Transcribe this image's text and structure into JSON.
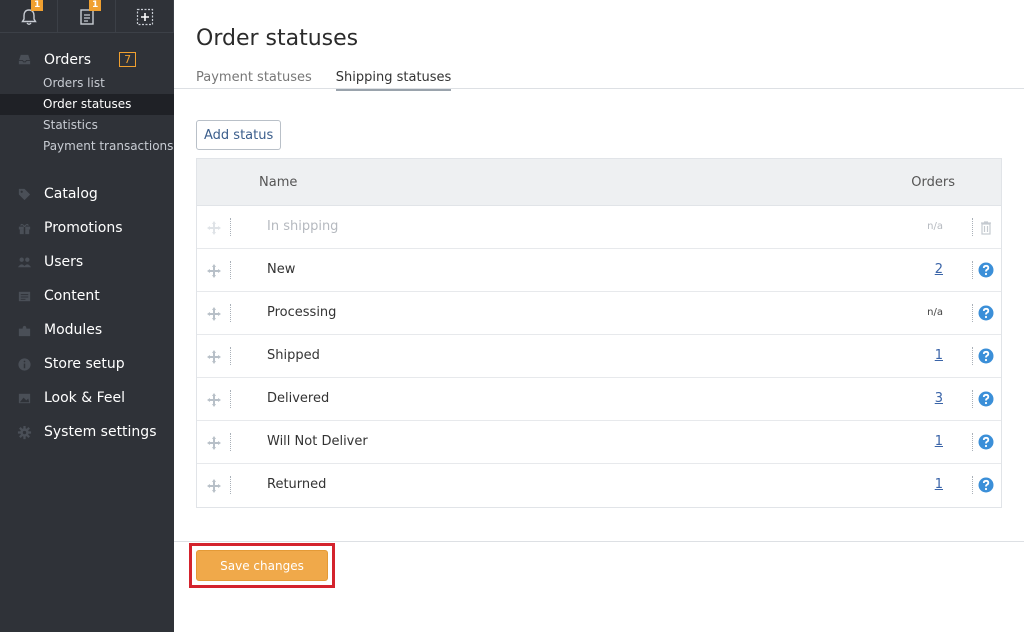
{
  "topbar": {
    "notifications_badge": "1",
    "documents_badge": "1"
  },
  "sidebar": {
    "orders_label": "Orders",
    "orders_count": "7",
    "orders_sub": [
      "Orders list",
      "Order statuses",
      "Statistics",
      "Payment transactions"
    ],
    "items": [
      "Catalog",
      "Promotions",
      "Users",
      "Content",
      "Modules",
      "Store setup",
      "Look & Feel",
      "System settings"
    ]
  },
  "main": {
    "title": "Order statuses",
    "tabs": [
      "Payment statuses",
      "Shipping statuses"
    ],
    "add_status": "Add status",
    "columns": {
      "name": "Name",
      "orders": "Orders"
    },
    "rows": [
      {
        "name": "In shipping",
        "orders": "n/a"
      },
      {
        "name": "New",
        "orders": "2"
      },
      {
        "name": "Processing",
        "orders": "n/a"
      },
      {
        "name": "Shipped",
        "orders": "1"
      },
      {
        "name": "Delivered",
        "orders": "3"
      },
      {
        "name": "Will Not Deliver",
        "orders": "1"
      },
      {
        "name": "Returned",
        "orders": "1"
      }
    ],
    "save_label": "Save changes"
  },
  "colors": {
    "sidebar_bg": "#2f3238",
    "accent": "#f0a94a",
    "link": "#3a64a8",
    "help_icon": "#3b8fd8",
    "highlight_frame": "#d4232d"
  }
}
